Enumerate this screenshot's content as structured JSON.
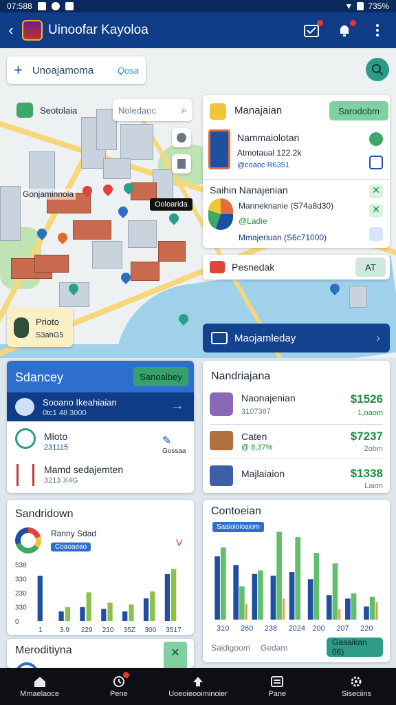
{
  "status": {
    "time": "07:588",
    "battery": "735%"
  },
  "appbar": {
    "title": "Uinoofar Kayoloa"
  },
  "search": {
    "value": "Unoajamoma",
    "tag": "Qosa"
  },
  "map": {
    "filter_label": "Seotolaia",
    "search_placeholder": "Noledaoc",
    "label_street": "Gonjaminnoia",
    "label_tag": "Ooloarida",
    "poi_title": "Prioto",
    "poi_sub": "S3ahG5"
  },
  "panel_top": {
    "title": "Manajaian",
    "button": "Sarodobm",
    "row1_title": "Nammaiolotan",
    "row1_line1": "Atmotaual 122.2k",
    "row1_line2": "@coaoc R6351",
    "row2_title": "Saihin Nanajenian",
    "row2_line1": "Manneknanie (S74a8d30)",
    "row2_line2": "@Ladie",
    "row2_line3": "Mmajeriuan (S6c71000)"
  },
  "bar_pending": {
    "label": "Pesnedak",
    "button": "AT"
  },
  "bar_manage": {
    "label": "Maojamleday"
  },
  "sdancey": {
    "title": "Sdancey",
    "button": "Sanoalbey",
    "row1_title": "Sooano Ikeahiaian",
    "row1_sub": "0tc1 48 3000",
    "row2_title": "Mioto",
    "row2_sub": "231115",
    "row2_action": "Gossaa",
    "row3_title": "Mamd sedajemten",
    "row3_sub": "3213 X4G"
  },
  "nandriajana": {
    "title": "Nandriajana",
    "items": [
      {
        "title": "Naonajenian",
        "sub": "3107367",
        "value": "$1526",
        "tag": "1,oaom"
      },
      {
        "title": "Caten",
        "sub": "@ 8,37%",
        "value": "$7237",
        "tag": "2obm"
      },
      {
        "title": "Majlaiaion",
        "sub": "",
        "value": "$1338",
        "tag": "Laion"
      }
    ]
  },
  "sandridown": {
    "title": "Sandridown",
    "legend_title": "Ranny Sdad",
    "legend_tag": "Coaoaeao",
    "chevron": "V"
  },
  "contoeian": {
    "title": "Contoeian",
    "tag": "Saaioioioaiom",
    "footer_left": "Saidigoom",
    "footer_mid": "Gedam",
    "footer_btn": "Gasaikan 06)"
  },
  "meroditiyna": {
    "title": "Meroditiyna"
  },
  "chart_data": [
    {
      "type": "bar",
      "categories": [
        "1",
        "3.9",
        "229",
        "210",
        "35Z",
        "300",
        "3517"
      ],
      "series": [
        {
          "name": "",
          "color": "#1e4fa0",
          "values": [
            520,
            110,
            160,
            140,
            110,
            260,
            540
          ]
        },
        {
          "name": "",
          "color": "#8cc04a",
          "values": [
            0,
            160,
            330,
            210,
            190,
            340,
            600
          ]
        }
      ],
      "y_ticks": [
        "0",
        "330",
        "230",
        "330",
        "538"
      ],
      "ylim": [
        0,
        650
      ]
    },
    {
      "type": "bar",
      "categories": [
        "310",
        "260",
        "238",
        "2024",
        "200",
        "207",
        "220"
      ],
      "series": [
        {
          "name": "",
          "color": "#1e4fa0",
          "values": [
            720,
            620,
            520,
            500,
            540,
            460,
            280,
            240,
            150
          ]
        },
        {
          "name": "",
          "color": "#5fbf6a",
          "values": [
            820,
            380,
            560,
            1000,
            940,
            760,
            640,
            300,
            260
          ]
        }
      ],
      "ylim": [
        0,
        1050
      ]
    }
  ],
  "bottomnav": [
    {
      "label": "Mmaelaoce",
      "icon": "home-icon"
    },
    {
      "label": "Pene",
      "icon": "clock-icon"
    },
    {
      "label": "Uoeoieooiminoier",
      "icon": "upload-icon"
    },
    {
      "label": "Pane",
      "icon": "list-icon"
    },
    {
      "label": "Siseciins",
      "icon": "settings-icon"
    }
  ],
  "colors": {
    "primary": "#0f3c86",
    "accent_green": "#37a06d",
    "bar_blue": "#1e4fa0",
    "bar_green": "#8cc04a"
  }
}
